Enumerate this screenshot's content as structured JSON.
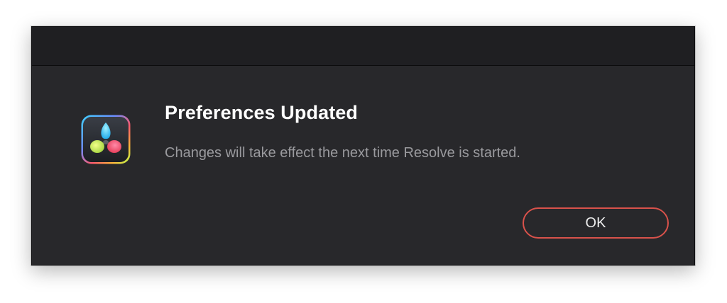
{
  "dialog": {
    "title": "Preferences Updated",
    "message": "Changes will take effect the next time Resolve is started.",
    "ok_label": "OK",
    "icon": "davinci-resolve-app-icon"
  },
  "colors": {
    "dialog_background": "#28282b",
    "titlebar_background": "#1f1f22",
    "title_text": "#ffffff",
    "message_text": "#9a9a9e",
    "button_border": "#d9524b"
  }
}
